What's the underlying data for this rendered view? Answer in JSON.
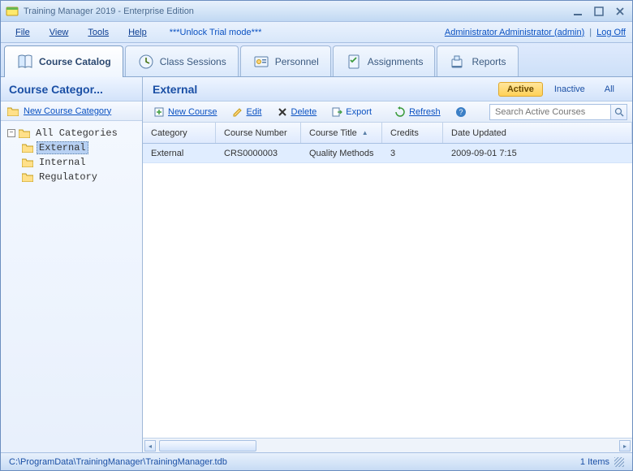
{
  "window": {
    "title": "Training Manager 2019 - Enterprise Edition"
  },
  "menu": {
    "items": [
      "File",
      "View",
      "Tools",
      "Help"
    ],
    "trial": "***Unlock Trial mode***",
    "user": "Administrator Administrator (admin)",
    "logoff": "Log Off"
  },
  "tabs": {
    "items": [
      {
        "label": "Course Catalog",
        "icon": "catalog"
      },
      {
        "label": "Class Sessions",
        "icon": "sessions"
      },
      {
        "label": "Personnel",
        "icon": "personnel"
      },
      {
        "label": "Assignments",
        "icon": "assignments"
      },
      {
        "label": "Reports",
        "icon": "reports"
      }
    ],
    "active_index": 0
  },
  "left": {
    "header": "Course Categor...",
    "new_label": "New Course Category",
    "tree": {
      "root": "All Categories",
      "children": [
        "External",
        "Internal",
        "Regulatory"
      ],
      "selected_index": 0
    }
  },
  "right": {
    "title": "External",
    "filters": {
      "active": "Active",
      "inactive": "Inactive",
      "all": "All",
      "selected": "active"
    },
    "toolbar": {
      "new": "New Course",
      "edit": "Edit",
      "delete": "Delete",
      "export": "Export",
      "refresh": "Refresh"
    },
    "search_placeholder": "Search Active Courses",
    "columns": [
      "Category",
      "Course Number",
      "Course Title",
      "Credits",
      "Date Updated"
    ],
    "sort_column_index": 2,
    "rows": [
      {
        "category": "External",
        "number": "CRS0000003",
        "title": "Quality Methods",
        "credits": "3",
        "updated": "2009-09-01 7:15"
      }
    ]
  },
  "status": {
    "path": "C:\\ProgramData\\TrainingManager\\TrainingManager.tdb",
    "count": "1 Items"
  }
}
